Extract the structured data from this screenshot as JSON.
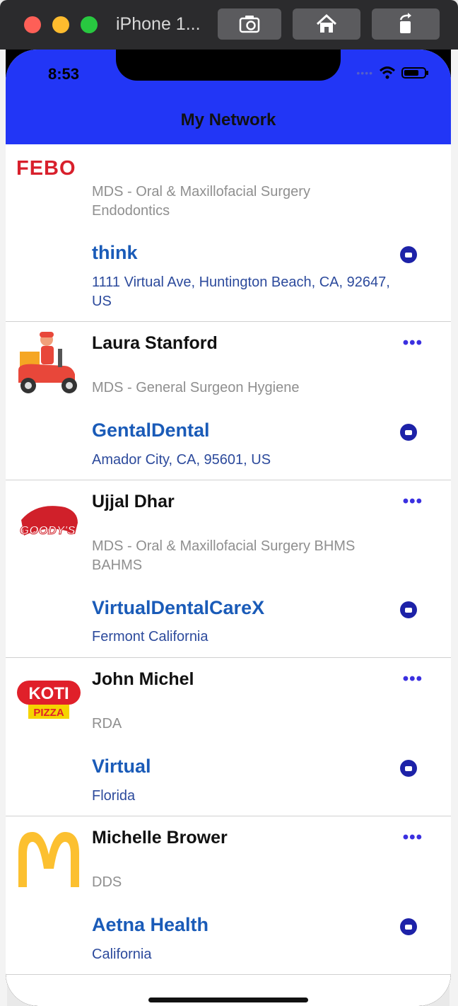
{
  "simulator": {
    "title": "iPhone 1..."
  },
  "status_bar": {
    "time": "8:53"
  },
  "nav": {
    "title": "My Network"
  },
  "contacts": [
    {
      "logo": "FEBO",
      "logo_icon": "febo-logo-icon",
      "name": "",
      "specialty": "MDS - Oral & Maxillofacial Surgery Endodontics",
      "practice": "think",
      "address": "1111 Virtual Ave, Huntington Beach, CA, 92647, US"
    },
    {
      "logo": "",
      "logo_icon": "delivery-scooter-icon",
      "name": "Laura Stanford",
      "specialty": "MDS - General Surgeon Hygiene",
      "practice": "GentalDental",
      "address": "Amador City, CA, 95601, US"
    },
    {
      "logo": "GOODY'S",
      "logo_icon": "goodys-logo-icon",
      "name": "Ujjal Dhar",
      "specialty": "MDS - Oral & Maxillofacial Surgery BHMS BAHMS",
      "practice": "VirtualDentalCareX",
      "address": "Fermont California"
    },
    {
      "logo": "KOTI PIZZA",
      "logo_icon": "koti-pizza-logo-icon",
      "name": "John Michel",
      "specialty": "RDA",
      "practice": "Virtual",
      "address": "Florida"
    },
    {
      "logo": "",
      "logo_icon": "mcdonalds-logo-icon",
      "name": "Michelle Brower",
      "specialty": "DDS",
      "practice": "Aetna Health",
      "address": "California"
    }
  ],
  "more_label": "•••",
  "colors": {
    "header_bg": "#2236f6",
    "practice_text": "#1a5bb8",
    "address_text": "#2c4a9c",
    "more_dots": "#3b30e0",
    "video_icon": "#1d22a8"
  }
}
